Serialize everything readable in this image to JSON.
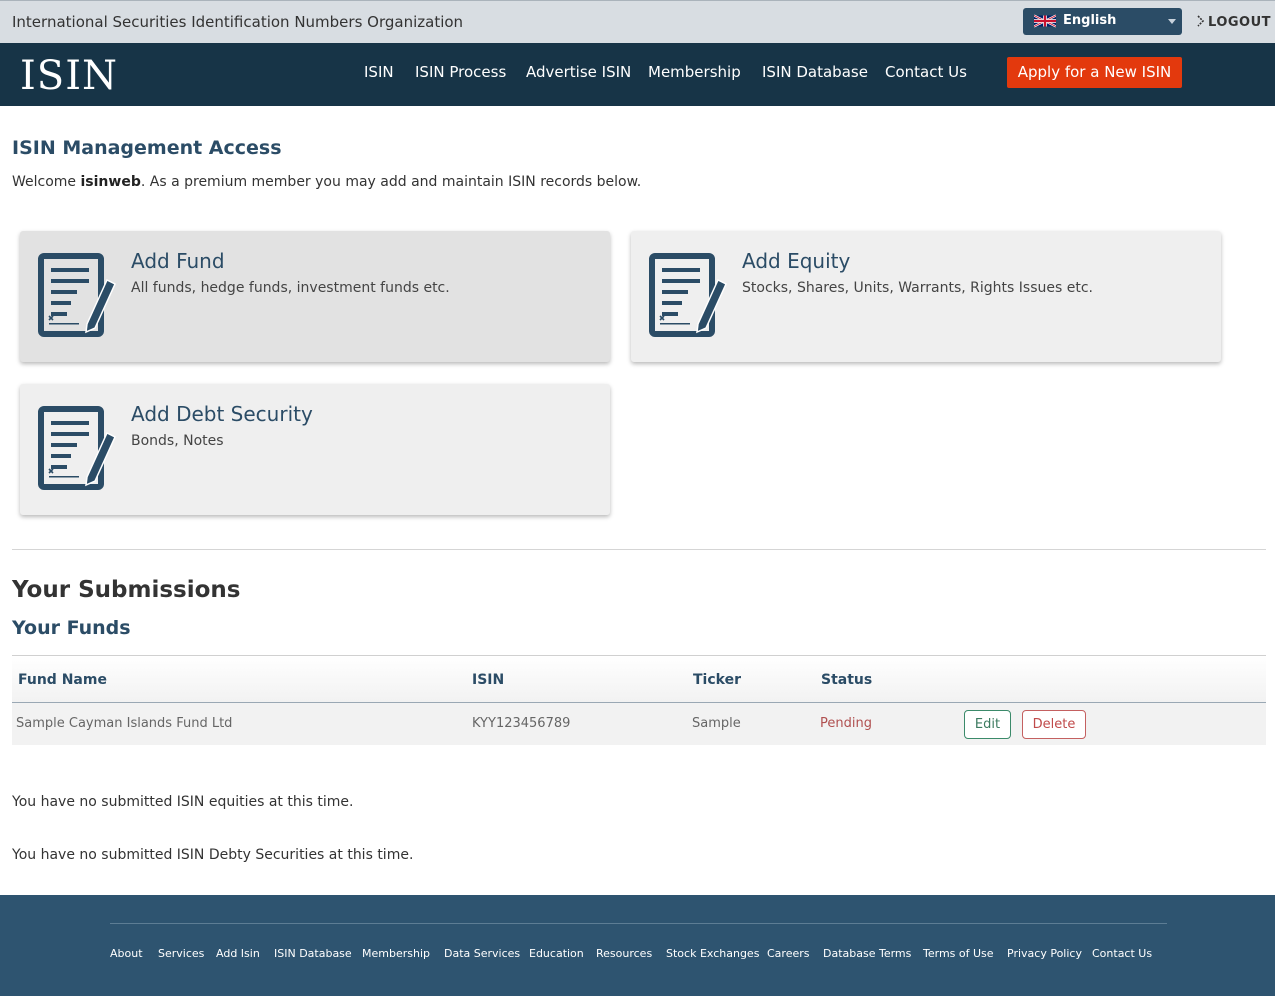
{
  "topbar": {
    "org_name": "International Securities Identification Numbers Organization",
    "language": "English",
    "language_icon": "uk-flag-icon",
    "logout": "LOGOUT"
  },
  "nav": {
    "logo": "ISIN",
    "items": [
      "ISIN",
      "ISIN Process",
      "Advertise ISIN",
      "Membership",
      "ISIN Database",
      "Contact Us"
    ],
    "apply_button": "Apply for a New ISIN"
  },
  "main": {
    "title": "ISIN Management Access",
    "welcome_prefix": "Welcome ",
    "username": "isinweb",
    "welcome_suffix": ". As a premium member you may add and maintain ISIN records below.",
    "cards": [
      {
        "title": "Add Fund",
        "description": "All funds, hedge funds, investment funds etc.",
        "icon": "document-edit-icon"
      },
      {
        "title": "Add Equity",
        "description": "Stocks, Shares, Units, Warrants, Rights Issues etc.",
        "icon": "document-edit-icon"
      },
      {
        "title": "Add Debt Security",
        "description": "Bonds, Notes",
        "icon": "document-edit-icon"
      }
    ]
  },
  "submissions": {
    "title": "Your Submissions",
    "funds_title": "Your Funds",
    "columns": [
      "Fund Name",
      "ISIN",
      "Ticker",
      "Status"
    ],
    "rows": [
      {
        "fund_name": "Sample Cayman Islands Fund Ltd",
        "isin": "KYY123456789",
        "ticker": "Sample",
        "status": "Pending"
      }
    ],
    "edit_label": "Edit",
    "delete_label": "Delete",
    "no_equities": "You have no submitted ISIN equities at this time.",
    "no_debt": "You have no submitted ISIN Debty Securities at this time."
  },
  "footer": {
    "links": [
      "About",
      "Services",
      "Add Isin",
      "ISIN Database",
      "Membership",
      "Data Services",
      "Education",
      "Resources",
      "Stock Exchanges",
      "Careers",
      "Database Terms",
      "Terms of Use",
      "Privacy Policy",
      "Contact Us"
    ]
  },
  "colors": {
    "nav_bg": "#173447",
    "accent": "#2b4c66",
    "apply_button": "#e3390d",
    "footer_bg": "#2e5470",
    "status_pending": "#b05050"
  }
}
